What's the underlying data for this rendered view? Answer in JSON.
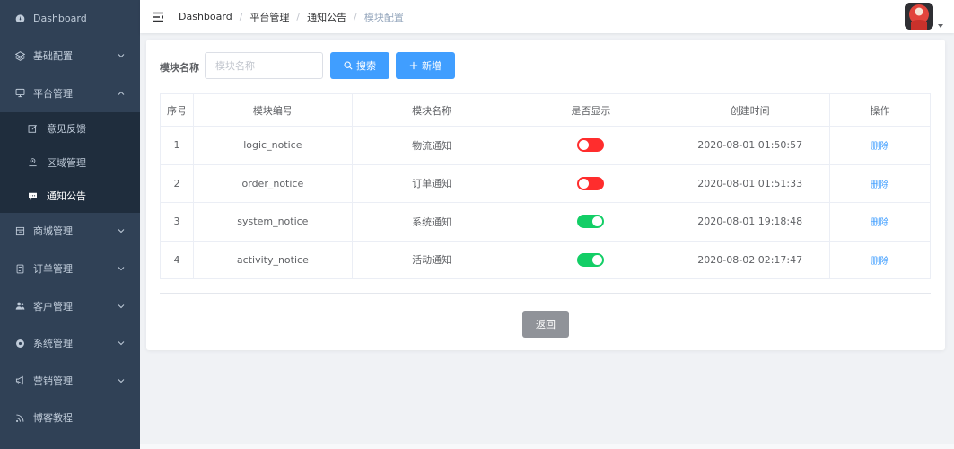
{
  "sidebar": {
    "items": [
      {
        "label": "Dashboard",
        "icon": "dashboard-icon",
        "has_arrow": false
      },
      {
        "label": "基础配置",
        "icon": "layers-icon",
        "has_arrow": true,
        "expanded": false
      },
      {
        "label": "平台管理",
        "icon": "monitor-icon",
        "has_arrow": true,
        "expanded": true
      },
      {
        "label": "商城管理",
        "icon": "shop-icon",
        "has_arrow": true,
        "expanded": false
      },
      {
        "label": "订单管理",
        "icon": "order-icon",
        "has_arrow": true,
        "expanded": false
      },
      {
        "label": "客户管理",
        "icon": "users-icon",
        "has_arrow": true,
        "expanded": false
      },
      {
        "label": "系统管理",
        "icon": "settings-icon",
        "has_arrow": true,
        "expanded": false
      },
      {
        "label": "营销管理",
        "icon": "megaphone-icon",
        "has_arrow": true,
        "expanded": false
      },
      {
        "label": "博客教程",
        "icon": "rss-icon",
        "has_arrow": false
      }
    ],
    "submenu": [
      {
        "label": "意见反馈",
        "icon": "edit-icon"
      },
      {
        "label": "区域管理",
        "icon": "location-icon"
      },
      {
        "label": "通知公告",
        "icon": "message-icon",
        "active": true
      }
    ]
  },
  "navbar": {
    "breadcrumb": [
      "Dashboard",
      "平台管理",
      "通知公告",
      "模块配置"
    ]
  },
  "filter": {
    "label": "模块名称",
    "placeholder": "模块名称",
    "value": "",
    "search_label": "搜索",
    "add_label": "新增"
  },
  "table": {
    "headers": [
      "序号",
      "模块编号",
      "模块名称",
      "是否显示",
      "创建时间",
      "操作"
    ],
    "rows": [
      {
        "idx": "1",
        "code": "logic_notice",
        "name": "物流通知",
        "show": false,
        "time": "2020-08-01 01:50:57",
        "op": "删除"
      },
      {
        "idx": "2",
        "code": "order_notice",
        "name": "订单通知",
        "show": false,
        "time": "2020-08-01 01:51:33",
        "op": "删除"
      },
      {
        "idx": "3",
        "code": "system_notice",
        "name": "系统通知",
        "show": true,
        "time": "2020-08-01 19:18:48",
        "op": "删除"
      },
      {
        "idx": "4",
        "code": "activity_notice",
        "name": "活动通知",
        "show": true,
        "time": "2020-08-02 02:17:47",
        "op": "删除"
      }
    ]
  },
  "footer": {
    "back_label": "返回"
  },
  "colors": {
    "sidebar_bg": "#304156",
    "submenu_bg": "#1f2d3d",
    "primary": "#409eff",
    "switch_on": "#13ce66",
    "switch_off": "#ff2d2d",
    "back_button": "#909399"
  }
}
